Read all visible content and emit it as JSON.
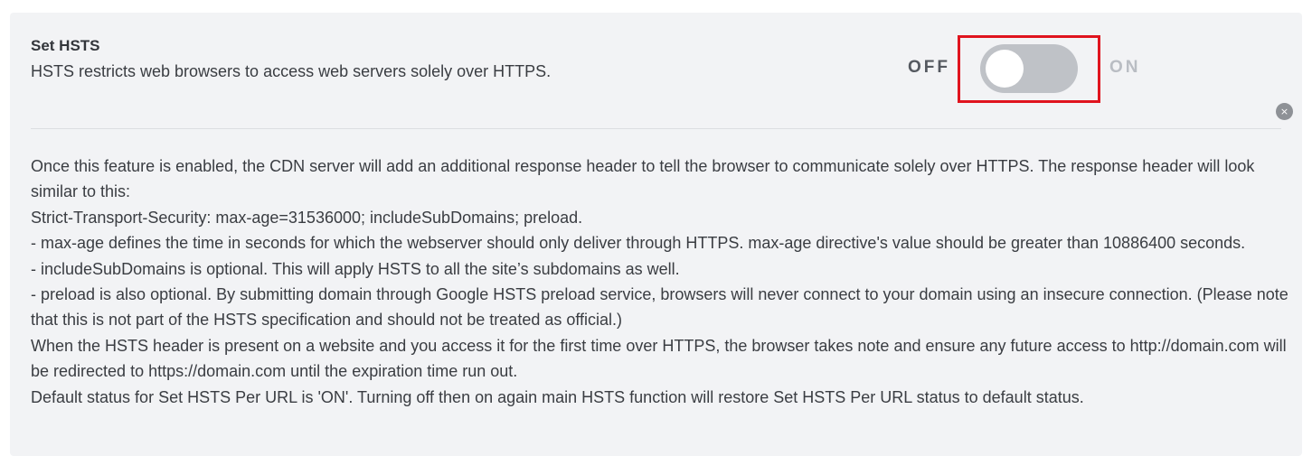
{
  "setting": {
    "title": "Set HSTS",
    "subtitle": "HSTS restricts web browsers to access web servers solely over HTTPS."
  },
  "toggle": {
    "off_label": "OFF",
    "on_label": "ON",
    "state": "off",
    "highlight_color": "#e0141e",
    "track_color": "#bfc2c7"
  },
  "close_button": {
    "glyph": "×",
    "icon": "close-icon"
  },
  "description": {
    "lines": [
      "Once this feature is enabled, the CDN server will add an additional response header to tell the browser to communicate solely over HTTPS. The response header will look similar to this:",
      "Strict-Transport-Security: max-age=31536000; includeSubDomains; preload.",
      "- max-age defines the time in seconds for which the webserver should only deliver through HTTPS. max-age directive's value should be greater than 10886400 seconds.",
      "- includeSubDomains is optional. This will apply HSTS to all the site’s subdomains as well.",
      "- preload is also optional. By submitting domain through Google HSTS preload service, browsers will never connect to your domain using an insecure connection. (Please note that this is not part of the HSTS specification and should not be treated as official.)",
      "When the HSTS header is present on a website and you access it for the first time over HTTPS, the browser takes note and ensure any future access to http://domain.com will be redirected to https://domain.com until the expiration time run out.",
      "Default status for Set HSTS Per URL is 'ON'. Turning off then on again main HSTS function will restore Set HSTS Per URL status to default status."
    ]
  }
}
